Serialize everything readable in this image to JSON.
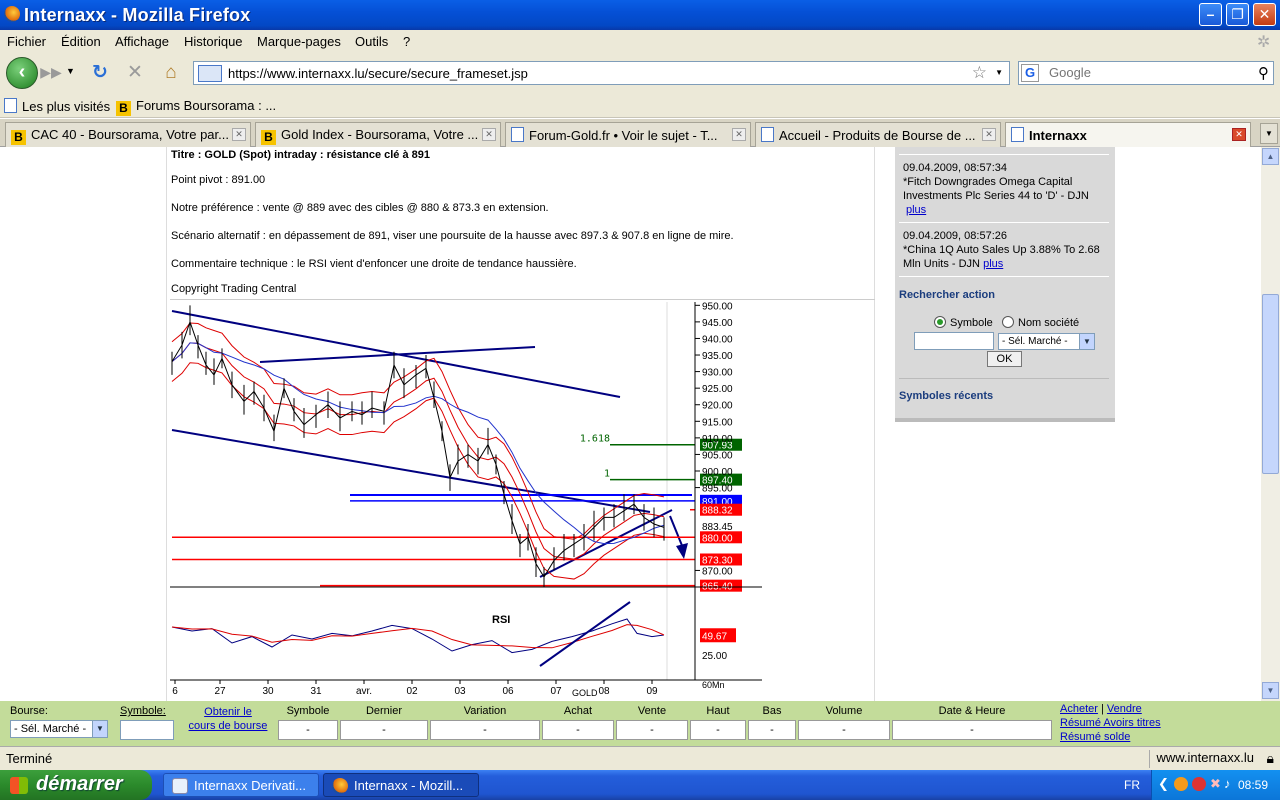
{
  "window": {
    "title": "Internaxx - Mozilla Firefox"
  },
  "menu": [
    "Fichier",
    "Édition",
    "Affichage",
    "Historique",
    "Marque-pages",
    "Outils",
    "?"
  ],
  "nav": {
    "url": "https://www.internaxx.lu/secure/secure_frameset.jsp",
    "search_placeholder": "Google"
  },
  "bookmarks": [
    "Les plus visités",
    "Forums Boursorama : ..."
  ],
  "tabs": [
    "CAC 40 - Boursorama, Votre par...",
    "Gold Index - Boursorama, Votre ...",
    "Forum-Gold.fr • Voir le sujet - T...",
    "Accueil - Produits de Bourse de ...",
    "Internaxx"
  ],
  "article": {
    "title": "Titre : GOLD (Spot) intraday : résistance clé à 891",
    "pivot": "Point pivot : 891.00",
    "preference": "Notre préférence : vente @ 889 avec des cibles @ 880 & 873.3 en extension.",
    "scenario": "Scénario alternatif : en dépassement de 891, viser une poursuite de la hausse avec 897.3 & 907.8 en ligne de mire.",
    "comment": "Commentaire technique : le RSI vient d'enfoncer une droite de tendance haussière.",
    "copyright": "Copyright Trading Central"
  },
  "chart_data": {
    "type": "line",
    "title": "",
    "symbol": "GOLD",
    "interval": "60Mn",
    "x_tick_labels": [
      "6",
      "27",
      "30",
      "31",
      "avr.",
      "02",
      "03",
      "06",
      "07",
      "08",
      "09"
    ],
    "y_tick_labels": [
      "950.00",
      "945.00",
      "940.00",
      "935.00",
      "930.00",
      "925.00",
      "920.00",
      "915.00",
      "910.00",
      "905.00",
      "900.00",
      "895.00",
      "870.00"
    ],
    "ylim": [
      865,
      951
    ],
    "levels": [
      {
        "label": "907.93",
        "value": 907.93,
        "color": "#006400",
        "fib": "1.618"
      },
      {
        "label": "897.40",
        "value": 897.4,
        "color": "#006400",
        "fib": "1"
      },
      {
        "label": "891.00",
        "value": 891.0,
        "color": "#0000ff"
      },
      {
        "label": "888.32",
        "value": 888.32,
        "color": "#ff0000"
      },
      {
        "label": "883.45",
        "value": 883.45,
        "color": "#000000"
      },
      {
        "label": "880.00",
        "value": 880.0,
        "color": "#ff0000"
      },
      {
        "label": "873.30",
        "value": 873.3,
        "color": "#ff0000"
      },
      {
        "label": "865.40",
        "value": 865.4,
        "color": "#ff0000"
      }
    ],
    "price_series": [
      {
        "x": 0,
        "y": 933
      },
      {
        "x": 10,
        "y": 938
      },
      {
        "x": 18,
        "y": 945
      },
      {
        "x": 26,
        "y": 938
      },
      {
        "x": 34,
        "y": 932
      },
      {
        "x": 42,
        "y": 929
      },
      {
        "x": 50,
        "y": 934
      },
      {
        "x": 60,
        "y": 926
      },
      {
        "x": 72,
        "y": 921
      },
      {
        "x": 82,
        "y": 924
      },
      {
        "x": 92,
        "y": 919
      },
      {
        "x": 102,
        "y": 912
      },
      {
        "x": 112,
        "y": 925
      },
      {
        "x": 122,
        "y": 918
      },
      {
        "x": 132,
        "y": 914
      },
      {
        "x": 144,
        "y": 917
      },
      {
        "x": 156,
        "y": 920
      },
      {
        "x": 168,
        "y": 916
      },
      {
        "x": 180,
        "y": 918
      },
      {
        "x": 190,
        "y": 917
      },
      {
        "x": 200,
        "y": 919
      },
      {
        "x": 212,
        "y": 918
      },
      {
        "x": 222,
        "y": 932
      },
      {
        "x": 232,
        "y": 926
      },
      {
        "x": 244,
        "y": 929
      },
      {
        "x": 254,
        "y": 931
      },
      {
        "x": 262,
        "y": 922
      },
      {
        "x": 270,
        "y": 912
      },
      {
        "x": 278,
        "y": 898
      },
      {
        "x": 286,
        "y": 903
      },
      {
        "x": 296,
        "y": 905
      },
      {
        "x": 306,
        "y": 903
      },
      {
        "x": 316,
        "y": 908
      },
      {
        "x": 324,
        "y": 902
      },
      {
        "x": 332,
        "y": 893
      },
      {
        "x": 340,
        "y": 885
      },
      {
        "x": 348,
        "y": 878
      },
      {
        "x": 356,
        "y": 880
      },
      {
        "x": 364,
        "y": 872
      },
      {
        "x": 372,
        "y": 868
      },
      {
        "x": 382,
        "y": 873
      },
      {
        "x": 392,
        "y": 876
      },
      {
        "x": 402,
        "y": 878
      },
      {
        "x": 412,
        "y": 880
      },
      {
        "x": 422,
        "y": 883
      },
      {
        "x": 432,
        "y": 886
      },
      {
        "x": 442,
        "y": 886
      },
      {
        "x": 452,
        "y": 888
      },
      {
        "x": 462,
        "y": 890
      },
      {
        "x": 472,
        "y": 886
      },
      {
        "x": 482,
        "y": 884
      },
      {
        "x": 492,
        "y": 883
      }
    ],
    "rsi": {
      "label": "RSI",
      "value": "49.67",
      "tick_label": "25.00",
      "series": [
        {
          "x": 0,
          "y": 60
        },
        {
          "x": 20,
          "y": 55
        },
        {
          "x": 40,
          "y": 58
        },
        {
          "x": 60,
          "y": 40
        },
        {
          "x": 80,
          "y": 48
        },
        {
          "x": 100,
          "y": 35
        },
        {
          "x": 120,
          "y": 50
        },
        {
          "x": 140,
          "y": 45
        },
        {
          "x": 160,
          "y": 52
        },
        {
          "x": 180,
          "y": 49
        },
        {
          "x": 200,
          "y": 55
        },
        {
          "x": 220,
          "y": 62
        },
        {
          "x": 240,
          "y": 58
        },
        {
          "x": 260,
          "y": 45
        },
        {
          "x": 280,
          "y": 30
        },
        {
          "x": 300,
          "y": 38
        },
        {
          "x": 320,
          "y": 43
        },
        {
          "x": 340,
          "y": 28
        },
        {
          "x": 360,
          "y": 32
        },
        {
          "x": 380,
          "y": 42
        },
        {
          "x": 400,
          "y": 48
        },
        {
          "x": 420,
          "y": 55
        },
        {
          "x": 440,
          "y": 64
        },
        {
          "x": 455,
          "y": 70
        },
        {
          "x": 465,
          "y": 52
        },
        {
          "x": 480,
          "y": 48
        },
        {
          "x": 492,
          "y": 50
        }
      ]
    }
  },
  "sidebar": {
    "news": [
      {
        "time": "09.04.2009, 08:57:34",
        "text": "*Fitch Downgrades Omega Capital Investments Plc Series 44 to 'D' -  DJN",
        "more": "plus"
      },
      {
        "time": "09.04.2009, 08:57:26",
        "text": "*China 1Q Auto Sales Up 3.88% To 2.68 Mln Units -  DJN",
        "more": "plus"
      }
    ],
    "search_title": "Rechercher action",
    "radio_symbol": "Symbole",
    "radio_company": "Nom société",
    "market_select": "- Sél. Marché -",
    "ok": "OK",
    "recent_title": "Symboles récents"
  },
  "quotebar": {
    "bourse_label": "Bourse:",
    "bourse_select": "- Sél. Marché -",
    "symbol_label": "Symbole:",
    "obtain_label_1": "Obtenir le",
    "obtain_label_2": "cours de bourse",
    "columns": [
      "Symbole",
      "Dernier",
      "Variation",
      "Achat",
      "Vente",
      "Haut",
      "Bas",
      "Volume",
      "Date & Heure"
    ],
    "cell_value": "-",
    "links": [
      "Acheter",
      "Vendre",
      "Résumé Avoirs titres",
      "Résumé solde"
    ]
  },
  "status": {
    "text": "Terminé",
    "domain": "www.internaxx.lu"
  },
  "taskbar": {
    "start": "démarrer",
    "tasks": [
      "Internaxx Derivati...",
      "Internaxx - Mozill..."
    ],
    "lang": "FR",
    "clock": "08:59"
  }
}
